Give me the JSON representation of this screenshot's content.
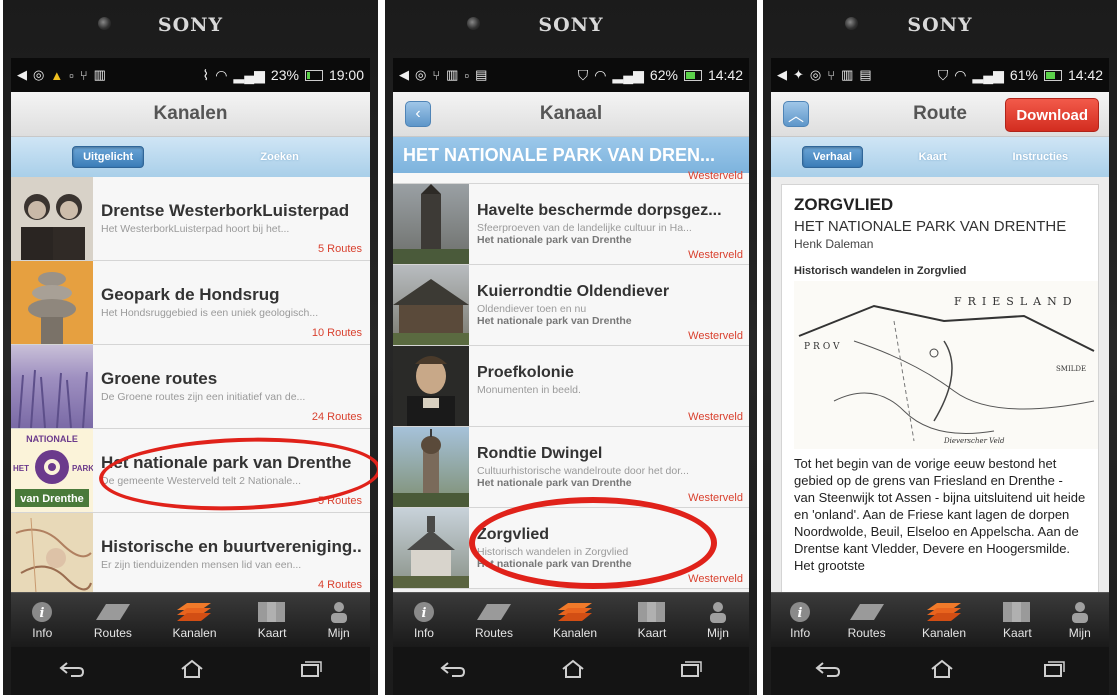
{
  "brand": "SONY",
  "phone1": {
    "status": {
      "battery": "23%",
      "time": "19:00"
    },
    "title": "Kanalen",
    "segments": [
      "Uitgelicht",
      "Zoeken"
    ],
    "items": [
      {
        "title": "Drentse WesterborkLuisterpad",
        "desc": "Het WesterborkLuisterpad hoort bij het...",
        "count": "5 Routes"
      },
      {
        "title": "Geopark de Hondsrug",
        "desc": "Het Hondsruggebied is een uniek geologisch...",
        "count": "10 Routes"
      },
      {
        "title": "Groene routes",
        "desc": "De Groene routes zijn een initiatief van de...",
        "count": "24 Routes"
      },
      {
        "title": "Het nationale park van Drenthe",
        "desc": "De gemeente Westerveld telt 2 Nationale...",
        "count": "5 Routes",
        "logo_top": "NATIONALE",
        "logo_left": "HET",
        "logo_right": "PARK",
        "logo_bottom": "van Drenthe"
      },
      {
        "title": "Historische en buurtvereniging...",
        "desc": "Er zijn tienduizenden mensen lid van een...",
        "count": "4 Routes"
      }
    ]
  },
  "phone2": {
    "status": {
      "battery": "62%",
      "time": "14:42"
    },
    "title": "Kanaal",
    "banner": "HET NATIONALE PARK VAN DREN...",
    "top_region": "Westerveld",
    "items": [
      {
        "title": "Havelte beschermde dorpsgez...",
        "desc": "Sfeerproeven van de landelijke cultuur in Ha...",
        "sub": "Het nationale park van Drenthe",
        "region": "Westerveld"
      },
      {
        "title": "Kuierrondtie Oldendiever",
        "desc": "Oldendiever toen en nu",
        "sub": "Het nationale park van Drenthe",
        "region": "Westerveld"
      },
      {
        "title": "Proefkolonie",
        "desc": "Monumenten in beeld.",
        "sub": "Het nationale park van Drenthe",
        "region": "Westerveld"
      },
      {
        "title": "Rondtie Dwingel",
        "desc": "Cultuurhistorische wandelroute door het dor...",
        "sub": "Het nationale park van Drenthe",
        "region": "Westerveld"
      },
      {
        "title": "Zorgvlied",
        "desc": "Historisch wandelen in Zorgvlied",
        "sub": "Het nationale park van Drenthe",
        "region": "Westerveld"
      }
    ]
  },
  "phone3": {
    "status": {
      "battery": "61%",
      "time": "14:42"
    },
    "title": "Route",
    "download": "Download",
    "segments": [
      "Verhaal",
      "Kaart",
      "Instructies"
    ],
    "heading": "ZORGVLIED",
    "park": "HET NATIONALE PARK VAN DRENTHE",
    "author": "Henk Daleman",
    "map_title": "Historisch wandelen in Zorgvlied",
    "map_labels": {
      "friesland": "FRIESLAND",
      "provincie": "PROV",
      "smilde": "SMILDE",
      "veld": "Dieverscher Veld"
    },
    "story": "Tot het begin van de vorige eeuw bestond het gebied op de grens van Friesland en Drenthe - van Steenwijk tot Assen - bijna uitsluitend uit heide en 'onland'. Aan de Friese kant lagen de dorpen Noordwolde, Beuil, Elseloo en Appelscha. Aan de Drentse kant Vledder, Devere en Hoogersmilde. Het grootste"
  },
  "tabs": [
    "Info",
    "Routes",
    "Kanalen",
    "Kaart",
    "Mijn"
  ],
  "colors": {
    "accent_red": "#e0221a",
    "count_red": "#d9412f",
    "tab_orange": "#f07a2a",
    "header_blue": "#a9cfe9"
  }
}
